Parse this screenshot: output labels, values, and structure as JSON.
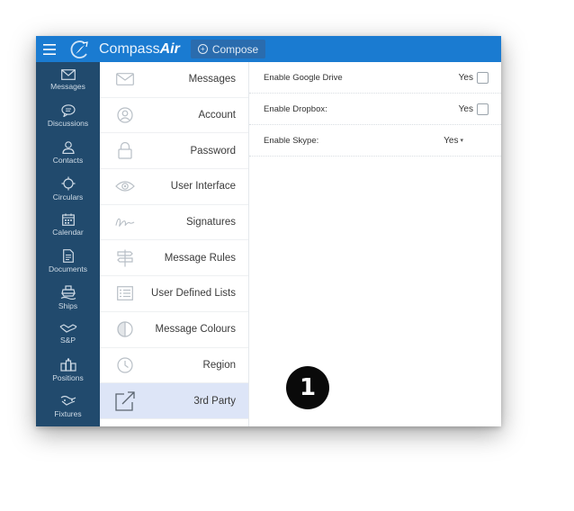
{
  "header": {
    "brand_part1": "Compass",
    "brand_part2": "Air",
    "compose_label": "Compose"
  },
  "leftnav": {
    "items": [
      {
        "label": "Messages",
        "icon": "envelope-icon"
      },
      {
        "label": "Discussions",
        "icon": "chat-bubble-icon"
      },
      {
        "label": "Contacts",
        "icon": "person-icon"
      },
      {
        "label": "Circulars",
        "icon": "circulars-icon"
      },
      {
        "label": "Calendar",
        "icon": "calendar-icon"
      },
      {
        "label": "Documents",
        "icon": "document-icon"
      },
      {
        "label": "Ships",
        "icon": "ship-icon"
      },
      {
        "label": "S&P",
        "icon": "handshake-icon"
      },
      {
        "label": "Positions",
        "icon": "positions-icon"
      },
      {
        "label": "Fixtures",
        "icon": "fixtures-icon"
      }
    ]
  },
  "settings_menu": {
    "items": [
      {
        "label": "Messages",
        "icon": "envelope-icon"
      },
      {
        "label": "Account",
        "icon": "account-icon"
      },
      {
        "label": "Password",
        "icon": "lock-icon"
      },
      {
        "label": "User Interface",
        "icon": "eye-icon"
      },
      {
        "label": "Signatures",
        "icon": "signature-icon"
      },
      {
        "label": "Message Rules",
        "icon": "signpost-icon"
      },
      {
        "label": "User Defined Lists",
        "icon": "list-icon"
      },
      {
        "label": "Message Colours",
        "icon": "palette-icon"
      },
      {
        "label": "Region",
        "icon": "clock-icon"
      },
      {
        "label": "3rd Party",
        "icon": "external-link-icon",
        "active": true
      }
    ]
  },
  "content": {
    "settings": [
      {
        "label": "Enable Google Drive",
        "value": "Yes",
        "control": "checkbox"
      },
      {
        "label": "Enable Dropbox:",
        "value": "Yes",
        "control": "checkbox"
      },
      {
        "label": "Enable Skype:",
        "value": "Yes",
        "control": "select"
      }
    ]
  },
  "callout_number": "1",
  "colors": {
    "header": "#1a7bd1",
    "leftnav": "#214a6d",
    "active_menu": "#dde5f7"
  }
}
